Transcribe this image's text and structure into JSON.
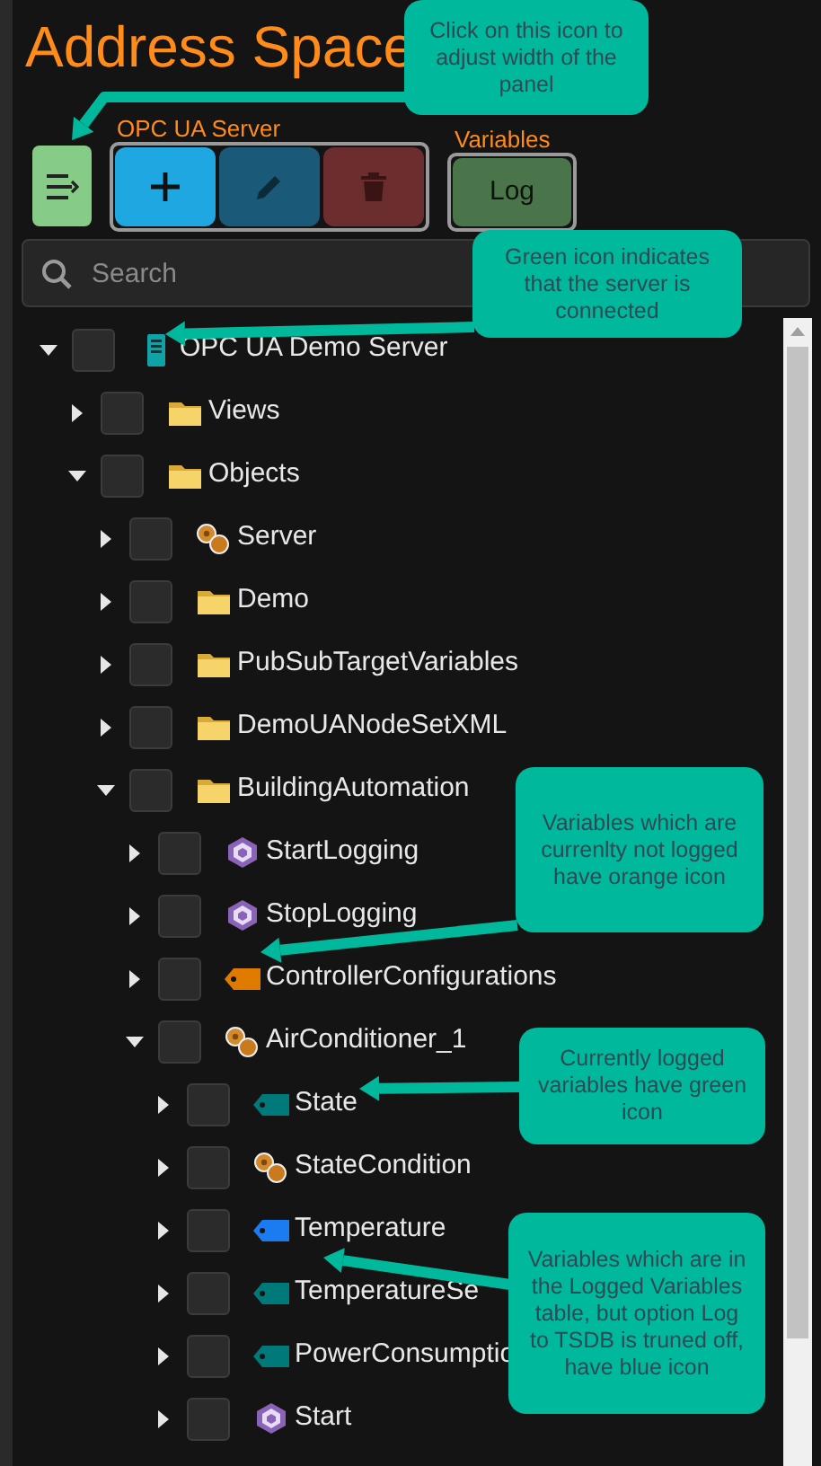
{
  "panel": {
    "title": "Address Space"
  },
  "toolbar": {
    "groups": [
      {
        "label": "OPC UA Server",
        "buttons": [
          {
            "kind": "add",
            "disabled": false
          },
          {
            "kind": "edit",
            "disabled": true
          },
          {
            "kind": "delete",
            "disabled": true
          }
        ]
      },
      {
        "label": "Variables",
        "buttons": [
          {
            "kind": "text",
            "label": "Log",
            "disabled": true
          }
        ]
      }
    ]
  },
  "search": {
    "placeholder": "Search"
  },
  "tree": [
    {
      "label": "OPC UA Demo Server",
      "kind": "server",
      "expanded": true,
      "checked": false,
      "children": [
        {
          "label": "Views",
          "kind": "folder",
          "expanded": false,
          "checked": false
        },
        {
          "label": "Objects",
          "kind": "folder",
          "expanded": true,
          "checked": false,
          "children": [
            {
              "label": "Server",
              "kind": "object",
              "expanded": false,
              "checked": false
            },
            {
              "label": "Demo",
              "kind": "folder",
              "expanded": false,
              "checked": false
            },
            {
              "label": "PubSubTargetVariables",
              "kind": "folder",
              "expanded": false,
              "checked": false
            },
            {
              "label": "DemoUANodeSetXML",
              "kind": "folder",
              "expanded": false,
              "checked": false
            },
            {
              "label": "BuildingAutomation",
              "kind": "folder",
              "expanded": true,
              "checked": false,
              "children": [
                {
                  "label": "StartLogging",
                  "kind": "method",
                  "expanded": false,
                  "checked": false
                },
                {
                  "label": "StopLogging",
                  "kind": "method",
                  "expanded": false,
                  "checked": false
                },
                {
                  "label": "ControllerConfigurations",
                  "kind": "variable",
                  "color": "#e07b00",
                  "expanded": false,
                  "checked": false
                },
                {
                  "label": "AirConditioner_1",
                  "kind": "object",
                  "expanded": true,
                  "checked": false,
                  "children": [
                    {
                      "label": "State",
                      "kind": "variable",
                      "color": "#00797a",
                      "expanded": false,
                      "checked": false
                    },
                    {
                      "label": "StateCondition",
                      "kind": "object",
                      "expanded": false,
                      "checked": false
                    },
                    {
                      "label": "Temperature",
                      "kind": "variable",
                      "color": "#1a7cf0",
                      "expanded": false,
                      "checked": false
                    },
                    {
                      "label": "TemperatureSe",
                      "kind": "variable",
                      "color": "#00797a",
                      "expanded": false,
                      "checked": false
                    },
                    {
                      "label": "PowerConsumptio",
                      "kind": "variable",
                      "color": "#00797a",
                      "expanded": false,
                      "checked": false
                    },
                    {
                      "label": "Start",
                      "kind": "method",
                      "expanded": false,
                      "checked": false
                    }
                  ]
                }
              ]
            }
          ]
        }
      ]
    }
  ],
  "callouts": [
    {
      "text": "Click on this icon to adjust width of the panel"
    },
    {
      "text": "Green icon indicates that the server is connected"
    },
    {
      "text": "Variables which are currenlty not logged have orange icon"
    },
    {
      "text": "Currently logged variables have green icon"
    },
    {
      "text": "Variables which are in the Logged Variables table, but option Log to TSDB is truned off, have blue icon"
    }
  ]
}
